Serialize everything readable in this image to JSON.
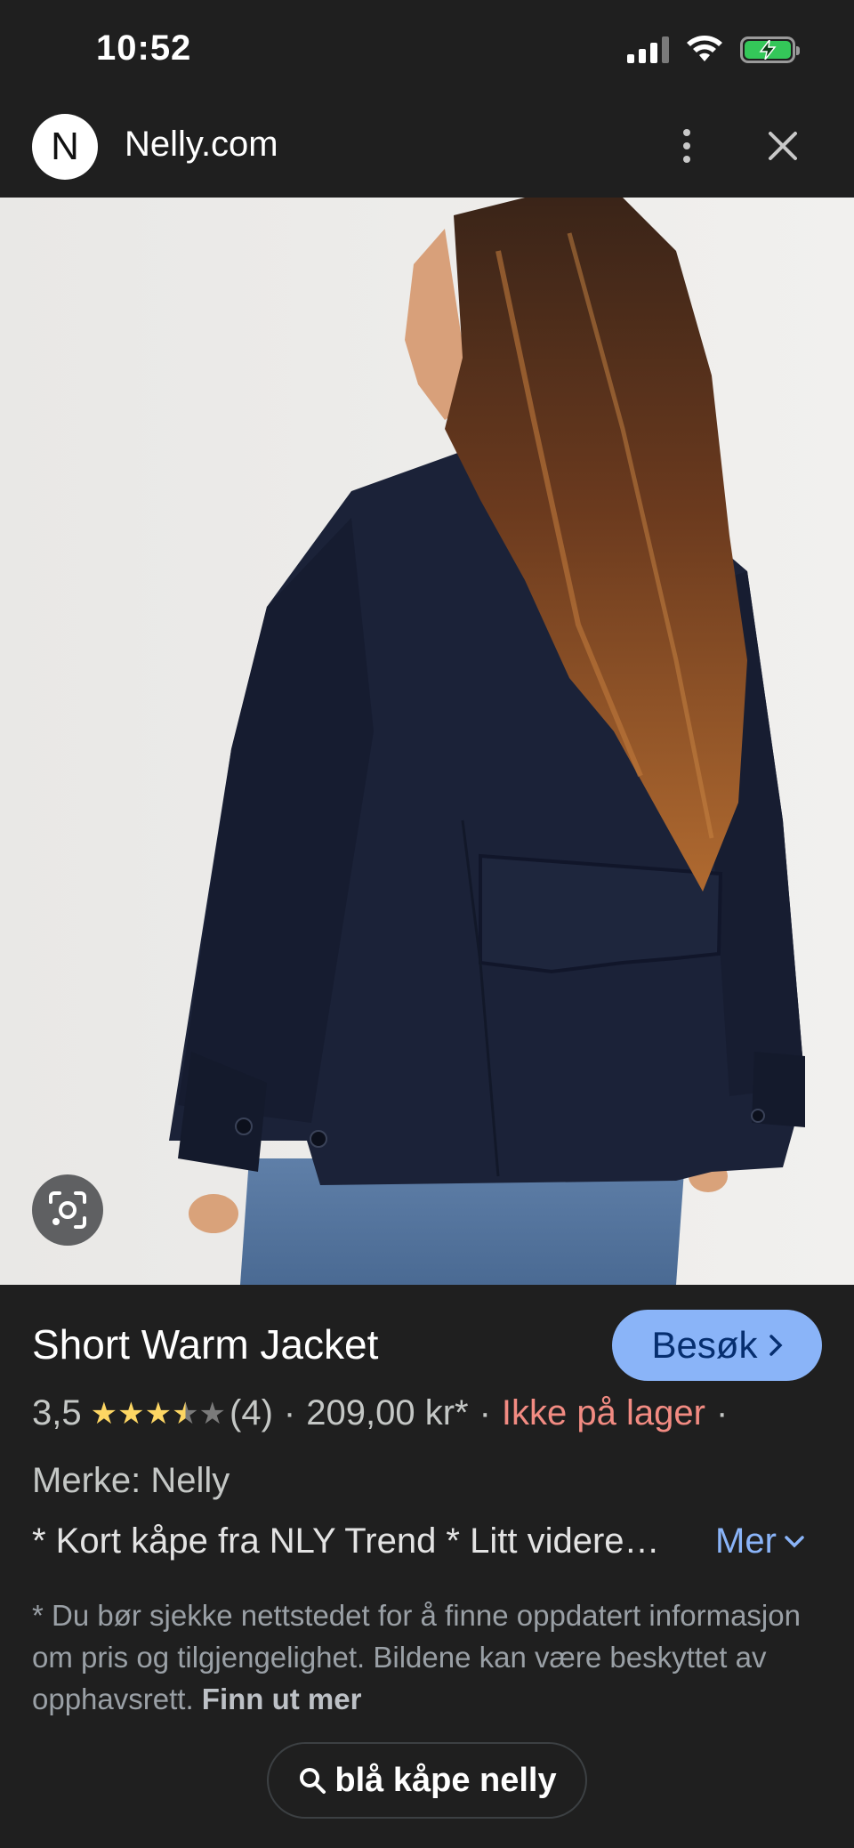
{
  "status_bar": {
    "time": "10:52"
  },
  "browser": {
    "site_initial": "N",
    "site_name": "Nelly.com",
    "more_icon": "more-vert-icon",
    "close_icon": "close-icon"
  },
  "product": {
    "title": "Short Warm Jacket",
    "visit_label": "Besøk",
    "rating_value": "3,5",
    "rating_fraction": 0.7,
    "review_count": "(4)",
    "separator": "·",
    "price": "209,00 kr*",
    "stock_status": "Ikke på lager",
    "brand": "Merke: Nelly",
    "description": "* Kort kåpe fra NLY Trend * Litt videre…",
    "more_label": "Mer",
    "disclaimer": "* Du bør sjekke nettstedet for å finne oppdatert informasjon om pris og tilgjengelighet. Bildene kan være beskyttet av opphavsrett.",
    "learn_more": "Finn ut mer"
  },
  "search_chip": {
    "query": "blå kåpe nelly"
  },
  "colors": {
    "accent_blue": "#8ab4f8",
    "out_of_stock": "#f28b82",
    "star_gold": "#fdd663",
    "jacket_navy": "#1b2238"
  }
}
